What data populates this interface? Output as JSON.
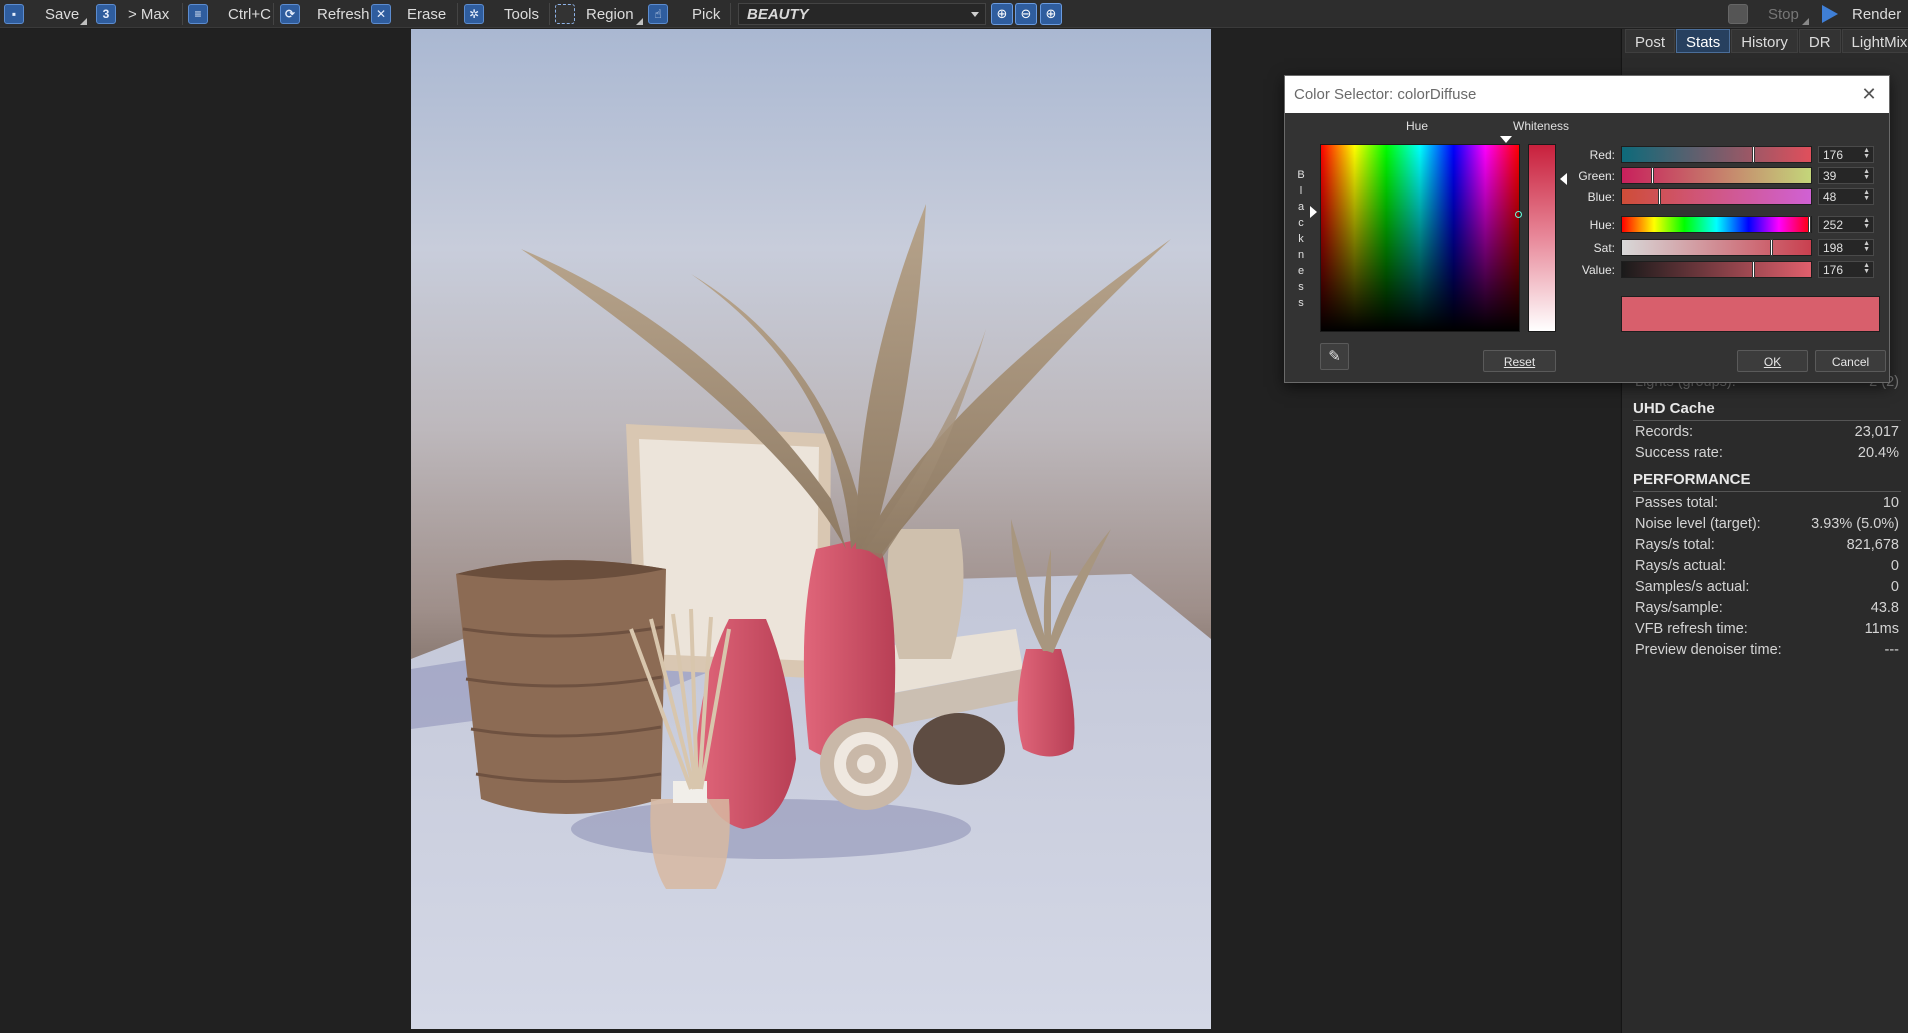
{
  "toolbar": {
    "save": "Save",
    "max": "> Max",
    "copy": "Ctrl+C",
    "refresh": "Refresh",
    "erase": "Erase",
    "tools": "Tools",
    "region": "Region",
    "pick": "Pick",
    "channel": "BEAUTY",
    "stop": "Stop",
    "render": "Render"
  },
  "tabs": [
    "Post",
    "Stats",
    "History",
    "DR",
    "LightMix"
  ],
  "active_tab": "Stats",
  "stats": {
    "lights_label": "Lights (groups):",
    "lights_value": "2 (2)",
    "uhd_title": "UHD Cache",
    "uhd": [
      {
        "label": "Records:",
        "value": "23,017"
      },
      {
        "label": "Success rate:",
        "value": "20.4%"
      }
    ],
    "perf_title": "PERFORMANCE",
    "perf": [
      {
        "label": "Passes total:",
        "value": "10"
      },
      {
        "label": "Noise level (target):",
        "value": "3.93% (5.0%)"
      },
      {
        "label": "Rays/s total:",
        "value": "821,678"
      },
      {
        "label": "Rays/s actual:",
        "value": "0"
      },
      {
        "label": "Samples/s actual:",
        "value": "0"
      },
      {
        "label": "Rays/sample:",
        "value": "43.8"
      },
      {
        "label": "VFB refresh time:",
        "value": "11ms"
      },
      {
        "label": "Preview denoiser time:",
        "value": "---"
      }
    ]
  },
  "dialog": {
    "title": "Color Selector: colorDiffuse",
    "hue_label": "Hue",
    "whiteness_label": "Whiteness",
    "blackness_letters": [
      "B",
      "l",
      "a",
      "c",
      "k",
      "n",
      "e",
      "s",
      "s"
    ],
    "channels": [
      {
        "label": "Red:",
        "value": "176"
      },
      {
        "label": "Green:",
        "value": "39"
      },
      {
        "label": "Blue:",
        "value": "48"
      },
      {
        "label": "Hue:",
        "value": "252"
      },
      {
        "label": "Sat:",
        "value": "198"
      },
      {
        "label": "Value:",
        "value": "176"
      }
    ],
    "reset": "Reset",
    "ok": "OK",
    "cancel": "Cancel",
    "current_color": "#d85f6c"
  },
  "colors": {
    "accent": "#2f5d9e",
    "active_tab": "#27405f",
    "vase_pink": "#d8556a"
  }
}
